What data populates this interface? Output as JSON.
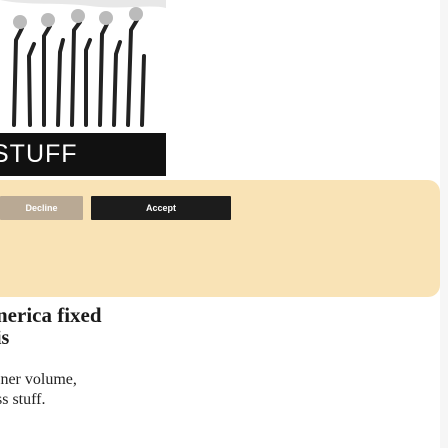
{
  "logo": {
    "wordmark": "STUFF"
  },
  "consent": {
    "decline_label": "Decline",
    "accept_label": "Accept"
  },
  "article": {
    "headline": "nerica fixed",
    "subhead": "is",
    "body_line1": "iner volume,",
    "body_line2": "ss stuff."
  }
}
